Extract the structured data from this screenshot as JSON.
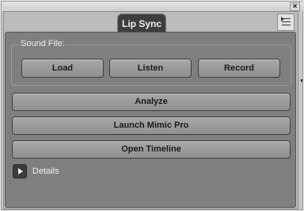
{
  "window": {
    "close_symbol": "×"
  },
  "tab": {
    "label": "Lip Sync"
  },
  "panel_menu": {
    "icon": "panel-menu-icon"
  },
  "sound_file": {
    "group_label": "Sound File:",
    "buttons": {
      "load": "Load",
      "listen": "Listen",
      "record": "Record"
    }
  },
  "actions": {
    "analyze": "Analyze",
    "launch_mimic": "Launch Mimic Pro",
    "open_timeline": "Open Timeline"
  },
  "details": {
    "label": "Details",
    "icon": "play-triangle-icon"
  },
  "colors": {
    "panel_bg": "#7f7f7f",
    "button_bg": "#9c9c9c",
    "tab_bg": "#3e3e3e"
  }
}
